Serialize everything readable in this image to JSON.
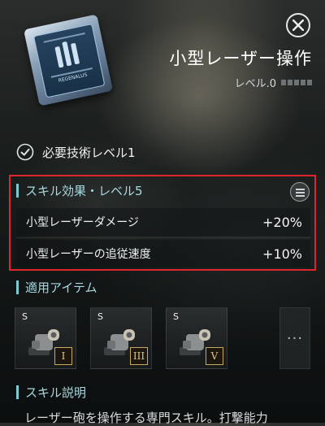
{
  "header": {
    "card_label": "REGENALUS",
    "skill_name": "小型レーザー操作",
    "level_label": "レベル.0",
    "level_pips": 5,
    "level_filled": 0
  },
  "requirement": {
    "text": "必要技術レベル1"
  },
  "effects": {
    "title": "スキル効果・レベル5",
    "rows": [
      {
        "name": "小型レーザーダメージ",
        "value": "+20%"
      },
      {
        "name": "小型レーザーの追従速度",
        "value": "+10%"
      }
    ]
  },
  "items": {
    "title": "適用アイテム",
    "slots": [
      {
        "size": "S",
        "tier": "I"
      },
      {
        "size": "S",
        "tier": "III"
      },
      {
        "size": "S",
        "tier": "V"
      }
    ],
    "more_label": "···"
  },
  "description": {
    "title": "スキル説明",
    "text": "レーザー砲を操作する専門スキル。打撃能力"
  },
  "colors": {
    "highlight_border": "#e1252c",
    "section_accent": "#7ec9d4",
    "tier_gold": "#c8a95b"
  }
}
